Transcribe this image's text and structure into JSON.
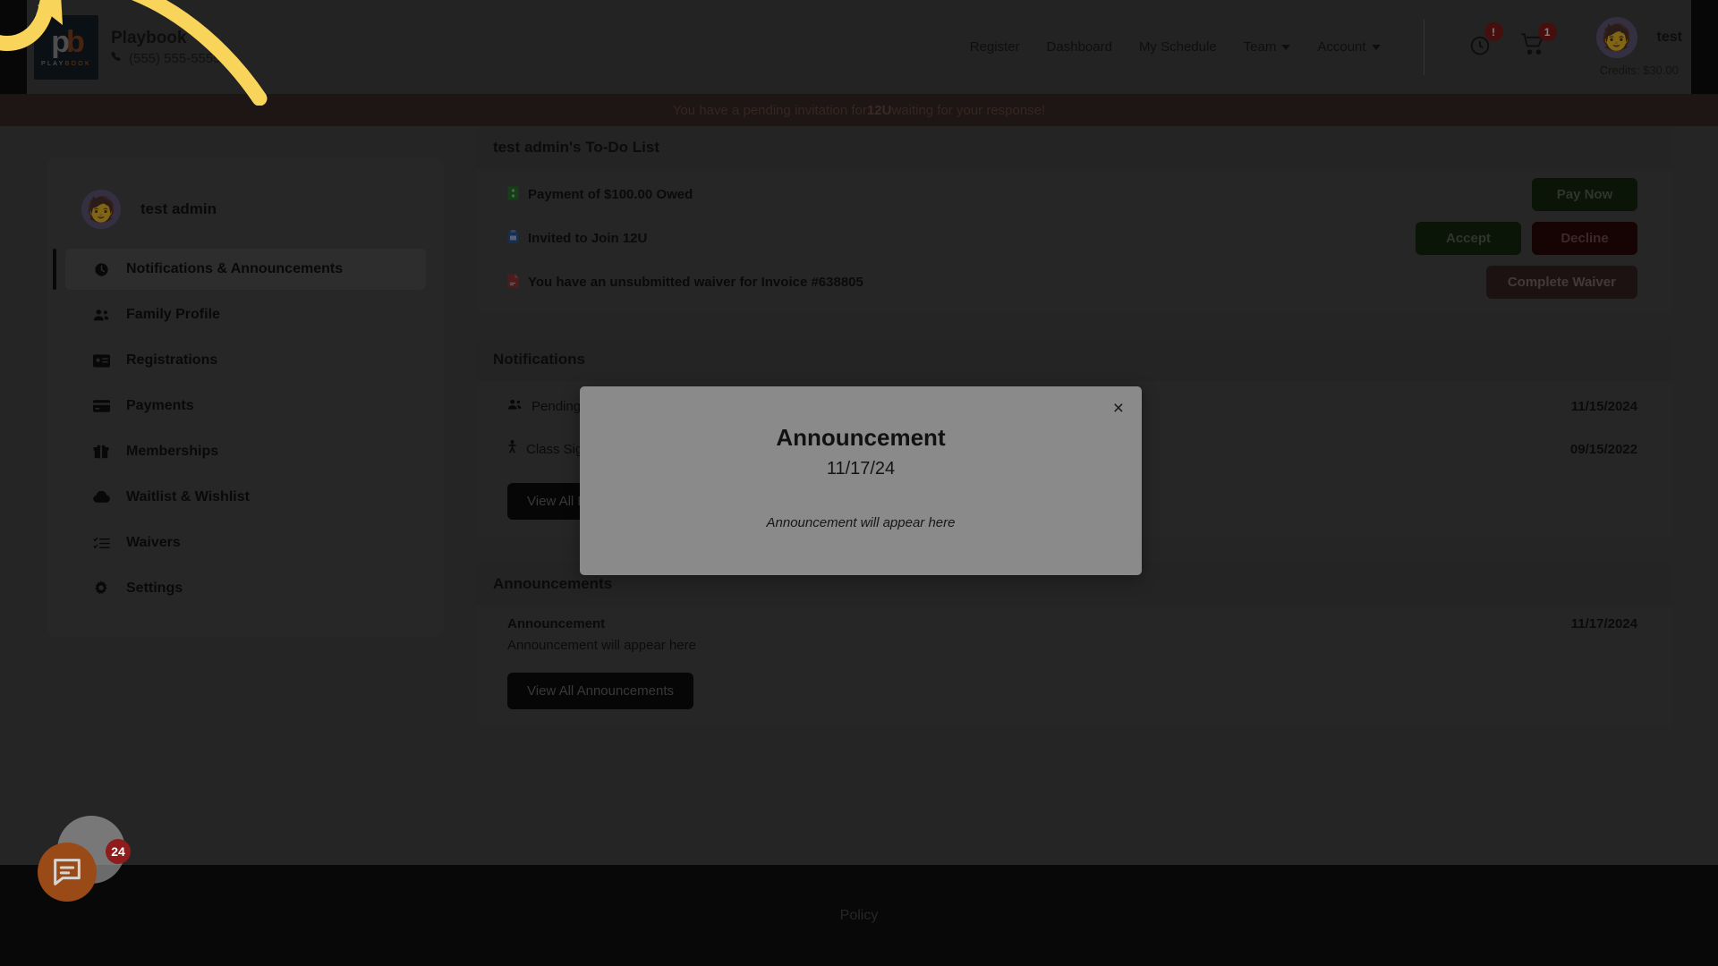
{
  "header": {
    "brand_name": "Playbook",
    "phone": "(555) 555-5555",
    "logo_mark": "pb",
    "logo_word_1": "PLAY",
    "logo_word_2": "BOOK",
    "nav": [
      {
        "label": "Register",
        "has_caret": false
      },
      {
        "label": "Dashboard",
        "has_caret": false
      },
      {
        "label": "My Schedule",
        "has_caret": false
      },
      {
        "label": "Team",
        "has_caret": true
      },
      {
        "label": "Account",
        "has_caret": true
      }
    ],
    "clock_icon": "clock-icon",
    "clock_badge": "!",
    "cart_icon": "cart-icon",
    "cart_badge": "1",
    "user_name": "test",
    "credits": "Credits: $30.00"
  },
  "invite_banner": {
    "prefix": "You have a pending invitation for ",
    "team": "12U",
    "suffix": " waiting for your response!"
  },
  "sidebar": {
    "user_name": "test admin",
    "items": [
      {
        "label": "Notifications & Announcements",
        "icon": "clock-icon",
        "active": true
      },
      {
        "label": "Family Profile",
        "icon": "people-icon",
        "active": false
      },
      {
        "label": "Registrations",
        "icon": "id-card-icon",
        "active": false
      },
      {
        "label": "Payments",
        "icon": "credit-card-icon",
        "active": false
      },
      {
        "label": "Memberships",
        "icon": "gift-icon",
        "active": false
      },
      {
        "label": "Waitlist & Wishlist",
        "icon": "cloud-icon",
        "active": false
      },
      {
        "label": "Waivers",
        "icon": "checklist-icon",
        "active": false
      },
      {
        "label": "Settings",
        "icon": "gear-icon",
        "active": false
      }
    ]
  },
  "todo": {
    "title": "test admin's To-Do List",
    "items": [
      {
        "icon": "money-bill-icon",
        "text": "Payment of $100.00 Owed",
        "buttons": [
          {
            "label": "Pay Now",
            "style": "pay"
          }
        ]
      },
      {
        "icon": "invite-icon",
        "text": "Invited to Join 12U",
        "buttons": [
          {
            "label": "Accept",
            "style": "accept"
          },
          {
            "label": "Decline",
            "style": "decline"
          }
        ]
      },
      {
        "icon": "file-signature-icon",
        "text": "You have an unsubmitted waiver for Invoice #638805",
        "buttons": [
          {
            "label": "Complete Waiver",
            "style": "waiver"
          }
        ]
      }
    ]
  },
  "notifications": {
    "title": "Notifications",
    "items": [
      {
        "icon": "people-icon",
        "text": "Pending",
        "date": "11/15/2024"
      },
      {
        "icon": "person-running-icon",
        "text": "Class Sig",
        "date": "09/15/2022"
      }
    ],
    "view_all_label": "View All Notifications"
  },
  "announcements": {
    "title": "Announcements",
    "items": [
      {
        "title": "Announcement",
        "body": "Announcement will appear here",
        "date": "11/17/2024"
      }
    ],
    "view_all_label": "View All Announcements"
  },
  "modal": {
    "close_label": "×",
    "title": "Announcement",
    "date": "11/17/24",
    "body": "Announcement will appear here"
  },
  "footer": {
    "policy_label": "Policy"
  },
  "chat": {
    "badge": "24",
    "icon": "chat-bubble-icon"
  },
  "colors": {
    "accent_orange": "#9a4a16",
    "badge_red": "#8e1c1c",
    "banner_bg": "#3a2d28",
    "annotation_yellow": "#f8d45a"
  }
}
